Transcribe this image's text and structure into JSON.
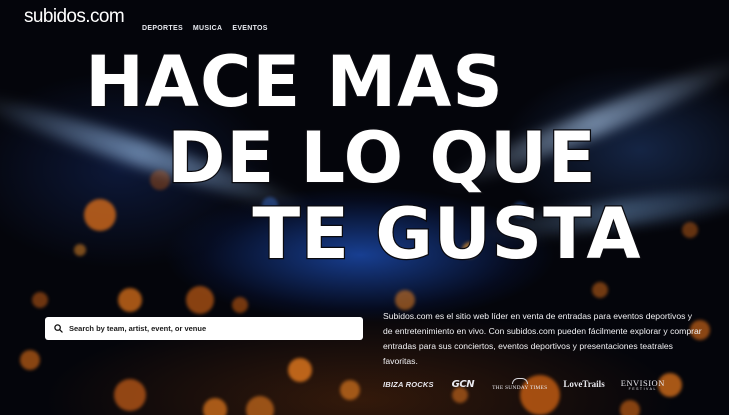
{
  "header": {
    "logo_text": "subidos.com",
    "nav": [
      {
        "label": "DEPORTES"
      },
      {
        "label": "MUSICA"
      },
      {
        "label": "EVENTOS"
      }
    ]
  },
  "hero": {
    "headline_lines": [
      "HACE MAS",
      "DE LO QUE",
      "TE GUSTA"
    ]
  },
  "search": {
    "placeholder": "Search by team, artist, event, or venue",
    "value": "",
    "icon": "search-icon"
  },
  "description": "Subidos.com es el sitio web líder en venta de entradas para eventos deportivos y de entretenimiento en vivo. Con subidos.com pueden fácilmente explorar y comprar entradas para sus conciertos, eventos deportivos y presentaciones teatrales favoritas.",
  "partners": {
    "ibiza_rocks": "IBIZA ROCKS",
    "gcn": "GCN",
    "sunday_times": "THE SUNDAY TIMES",
    "love_trails": "LoveTrails",
    "envision": "ENVISION",
    "envision_sub": "FESTIVAL"
  },
  "colors": {
    "background": "#05060c",
    "text": "#ffffff",
    "search_bg": "#ffffff"
  }
}
